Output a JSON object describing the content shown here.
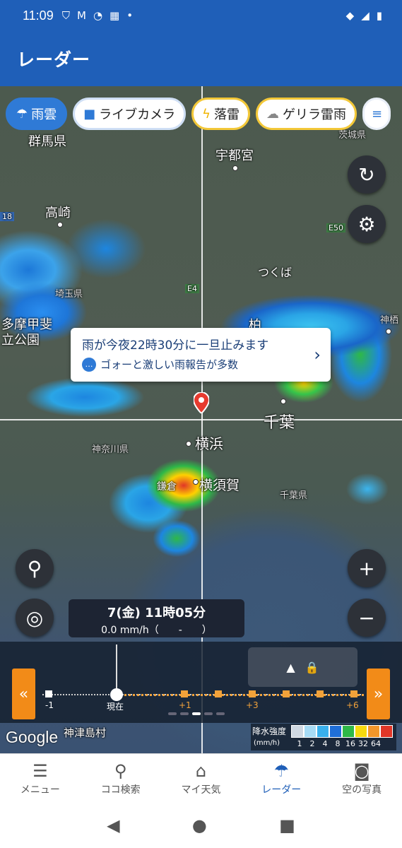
{
  "status_bar": {
    "time": "11:09",
    "icons": [
      "shield-icon",
      "mail-icon",
      "app-icon",
      "calendar-icon",
      "dot-icon"
    ],
    "right_icons": [
      "wifi-icon",
      "signal-icon",
      "battery-icon"
    ]
  },
  "app_bar": {
    "title": "レーダー"
  },
  "chips": [
    {
      "label": "雨雲",
      "icon": "rain-cloud-icon",
      "selected": true
    },
    {
      "label": "ライブカメラ",
      "icon": "camera-icon"
    },
    {
      "label": "落雷",
      "icon": "lightning-icon"
    },
    {
      "label": "ゲリラ雷雨",
      "icon": "storm-icon"
    }
  ],
  "map_labels": {
    "gunma": "群馬県",
    "utsunomiya": "宇都宮",
    "takasaki": "高崎",
    "tsukuba": "つくば",
    "saitama": "埼玉県",
    "tama": "多摩甲斐",
    "tama2": "立公園",
    "kashiwa": "柏",
    "chiba": "千葉",
    "kanagawa": "神奈川県",
    "yokohama": "横浜",
    "kamakura": "鎌倉",
    "yokosuka": "横須賀",
    "chiba_pref": "千葉県",
    "ibaraki": "茨城県",
    "kami": "神栖",
    "e4": "E4",
    "e50": "E50",
    "r18": "18"
  },
  "popup": {
    "line1": "雨が今夜22時30分に一旦止みます",
    "line2": "ゴォーと激しい雨報告が多数"
  },
  "timebox": {
    "datetime": "7(金) 11時05分",
    "rate": "0.0 mm/h（　　-　　）"
  },
  "timeline": {
    "labels": [
      "-1",
      "現在",
      "+1",
      "+3",
      "+6"
    ]
  },
  "google": {
    "logo": "Google",
    "place": "神津島村"
  },
  "legend": {
    "title": "降水強度",
    "unit": "(mm/h)",
    "values": [
      "1",
      "2",
      "4",
      "8",
      "16",
      "32",
      "64"
    ],
    "colors": [
      "#cfd8e2",
      "#a6dbf5",
      "#3ab0ec",
      "#1f6fd9",
      "#2eb848",
      "#f6d90f",
      "#f2962a",
      "#e03628"
    ]
  },
  "bottom_nav": [
    {
      "label": "メニュー",
      "icon": "menu-icon"
    },
    {
      "label": "ココ検索",
      "icon": "search-icon"
    },
    {
      "label": "マイ天気",
      "icon": "home-icon"
    },
    {
      "label": "レーダー",
      "icon": "umbrella-icon",
      "active": true
    },
    {
      "label": "空の写真",
      "icon": "camera-icon"
    }
  ],
  "system_nav": [
    "back-icon",
    "home-icon",
    "recents-icon"
  ]
}
